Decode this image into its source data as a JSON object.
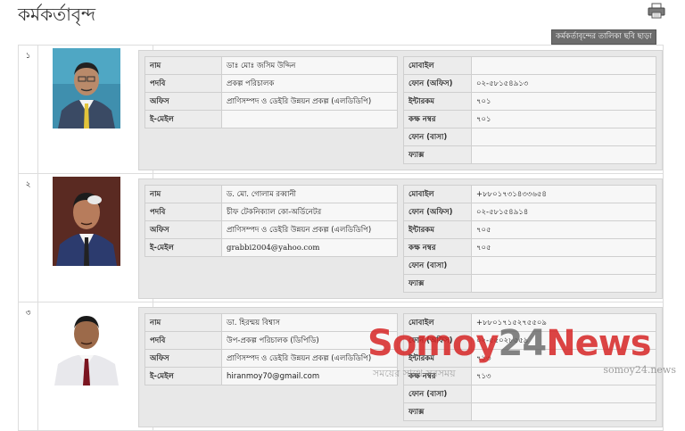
{
  "page": {
    "title": "কর্মকর্তাবৃন্দ",
    "no_photo_label": "কর্মকর্তাবৃন্দের তালিকা ছবি ছাড়া",
    "print_icon": "printer-icon"
  },
  "labels": {
    "name": "নাম",
    "designation": "পদবি",
    "office": "অফিস",
    "email": "ই-মেইল",
    "mobile": "মোবাইল",
    "phone_office": "ফোন (অফিস)",
    "intercom": "ইন্টারকম",
    "room": "কক্ষ নম্বর",
    "phone_home": "ফোন (বাসা)",
    "fax": "ফ্যাক্স"
  },
  "officers": [
    {
      "serial": "১",
      "name": "ডাঃ মোঃ জসিম উদ্দিন",
      "designation": "প্রকল্প পরিচালক",
      "office": "প্রাণিসম্পদ ও ডেইরি উন্নয়ন প্রকল্প (এলডিডিপি)",
      "email": "",
      "mobile": "",
      "phone_office": "০২-৫৮১৫৪৯১৩",
      "intercom": "৭০১",
      "room": "৭০১",
      "phone_home": "",
      "fax": ""
    },
    {
      "serial": "২",
      "name": "ড. মো. গোলাম রব্বানী",
      "designation": "চীফ টেকনিক্যাল কো-অর্ডিনেটর",
      "office": "প্রাণিসম্পদ ও ডেইরি উন্নয়ন প্রকল্প (এলডিডিপি)",
      "email": "grabbi2004@yahoo.com",
      "mobile": "+৮৮০১৭৩১৪৩৩৬৫৪",
      "phone_office": "০২-৫৮১৫৪৯১৪",
      "intercom": "৭০৫",
      "room": "৭০৫",
      "phone_home": "",
      "fax": ""
    },
    {
      "serial": "৩",
      "name": "ডা. হিরন্ময় বিশ্বাস",
      "designation": "উপ-প্রকল্প পরিচালক (ডিপিডি)",
      "office": "প্রাণিসম্পদ ও ডেইরি উন্নয়ন প্রকল্প (এলডিডিপি)",
      "email": "hiranmoy70@gmail.com",
      "mobile": "+৮৮০১৭১৫২৭৫৫০৯",
      "phone_office": "০২-৫৫০২৮৫৫৯",
      "intercom": "৭১৩",
      "room": "৭১৩",
      "phone_home": "",
      "fax": ""
    }
  ],
  "watermark": {
    "logo_left": "Somoy",
    "logo_mid": "24",
    "logo_right": "News",
    "url": "somoy24.news",
    "tagline": "সময়ের সাথে সবসময়"
  }
}
